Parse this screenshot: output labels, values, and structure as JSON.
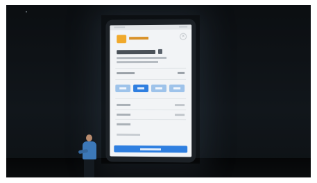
{
  "colors": {
    "stage_background": "#0d1114",
    "phone_body": "#1c2126",
    "screen_background": "#f2f4f6",
    "accent_blue": "#2f7fe0",
    "logo_orange": "#f0a92b",
    "presenter_shirt": "#3c78b8"
  },
  "screen": {
    "tabs_count": 4,
    "active_tab_index": 1,
    "icons": [
      "app-logo-icon",
      "close-icon"
    ]
  }
}
